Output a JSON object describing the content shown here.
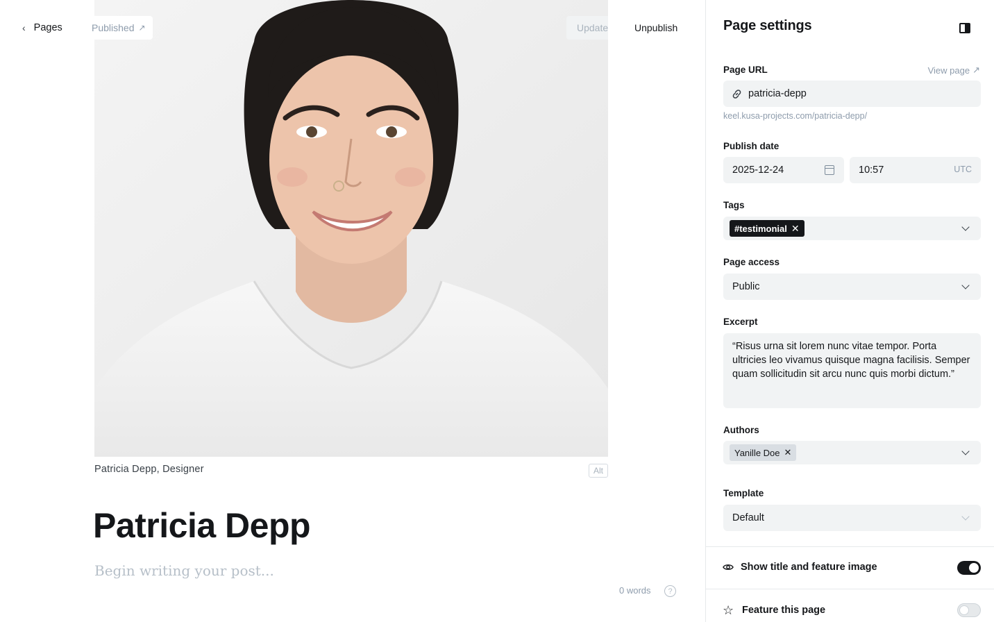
{
  "header": {
    "back_label": "Pages",
    "status_label": "Published",
    "status_icon": "external-arrow-icon",
    "update_label": "Update",
    "unpublish_label": "Unpublish"
  },
  "feature_image": {
    "caption": "Patricia Depp, Designer",
    "alt_button_label": "Alt"
  },
  "post": {
    "title": "Patricia Depp",
    "body_placeholder": "Begin writing your post...",
    "word_count": "0 words",
    "help_icon_glyph": "?"
  },
  "settings": {
    "title": "Page settings",
    "page_url": {
      "label": "Page URL",
      "view_page_label": "View page",
      "value": "patricia-depp",
      "full_url": "keel.kusa-projects.com/patricia-depp/"
    },
    "publish_date": {
      "label": "Publish date",
      "date": "2025-12-24",
      "time": "10:57",
      "timezone": "UTC"
    },
    "tags": {
      "label": "Tags",
      "items": [
        "#testimonial"
      ]
    },
    "page_access": {
      "label": "Page access",
      "value": "Public"
    },
    "excerpt": {
      "label": "Excerpt",
      "value": "“Risus urna sit lorem nunc vitae tempor. Porta ultricies leo vivamus quisque magna facilisis. Semper quam sollicitudin sit arcu nunc quis morbi dictum.”"
    },
    "authors": {
      "label": "Authors",
      "items": [
        "Yanille Doe"
      ]
    },
    "template": {
      "label": "Template",
      "value": "Default"
    },
    "show_title_and_feature_image": {
      "label": "Show title and feature image",
      "enabled": true
    },
    "feature_this_page": {
      "label": "Feature this page",
      "enabled": false
    }
  },
  "colors": {
    "text_primary": "#15171a",
    "text_muted": "#8e9cac",
    "input_bg": "#f1f3f4",
    "toggle_on": "#15171a"
  }
}
